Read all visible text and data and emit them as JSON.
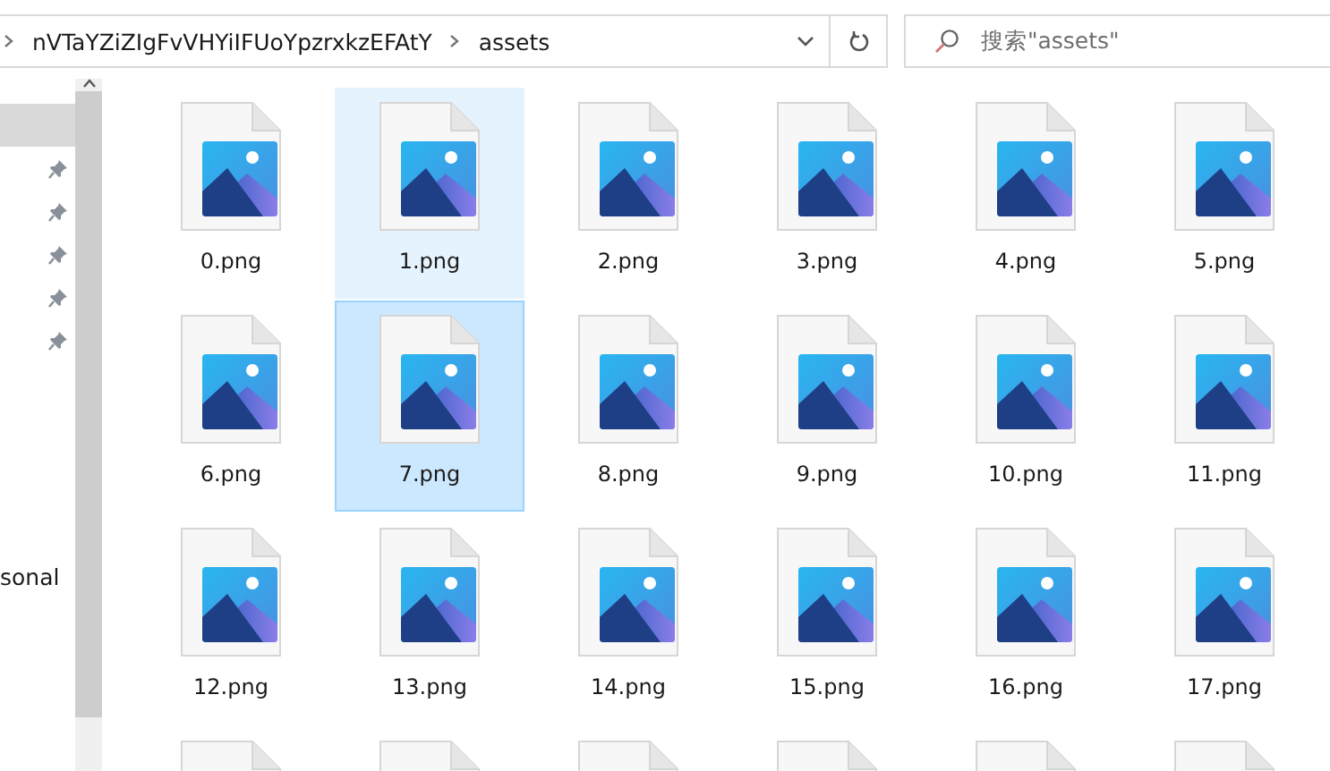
{
  "address_bar": {
    "path": [
      {
        "label": "nVTaYZiZIgFvVHYiIFUoYpzrxkzEFAtY"
      },
      {
        "label": "assets"
      }
    ]
  },
  "search": {
    "placeholder": "搜索\"assets\""
  },
  "sidebar": {
    "items": [
      {
        "selected": true,
        "pinned": false
      },
      {
        "selected": false,
        "pinned": true
      },
      {
        "selected": false,
        "pinned": true
      },
      {
        "selected": false,
        "pinned": true
      },
      {
        "selected": false,
        "pinned": true
      },
      {
        "selected": false,
        "pinned": true
      },
      {
        "label": "sonal",
        "selected": false,
        "pinned": false
      }
    ]
  },
  "files": [
    {
      "name": "0.png",
      "selected": false,
      "hovered": false
    },
    {
      "name": "1.png",
      "selected": false,
      "hovered": true
    },
    {
      "name": "2.png",
      "selected": false,
      "hovered": false
    },
    {
      "name": "3.png",
      "selected": false,
      "hovered": false
    },
    {
      "name": "4.png",
      "selected": false,
      "hovered": false
    },
    {
      "name": "5.png",
      "selected": false,
      "hovered": false
    },
    {
      "name": "6.png",
      "selected": false,
      "hovered": false
    },
    {
      "name": "7.png",
      "selected": true,
      "hovered": false
    },
    {
      "name": "8.png",
      "selected": false,
      "hovered": false
    },
    {
      "name": "9.png",
      "selected": false,
      "hovered": false
    },
    {
      "name": "10.png",
      "selected": false,
      "hovered": false
    },
    {
      "name": "11.png",
      "selected": false,
      "hovered": false
    },
    {
      "name": "12.png",
      "selected": false,
      "hovered": false
    },
    {
      "name": "13.png",
      "selected": false,
      "hovered": false
    },
    {
      "name": "14.png",
      "selected": false,
      "hovered": false
    },
    {
      "name": "15.png",
      "selected": false,
      "hovered": false
    },
    {
      "name": "16.png",
      "selected": false,
      "hovered": false
    },
    {
      "name": "17.png",
      "selected": false,
      "hovered": false
    }
  ]
}
